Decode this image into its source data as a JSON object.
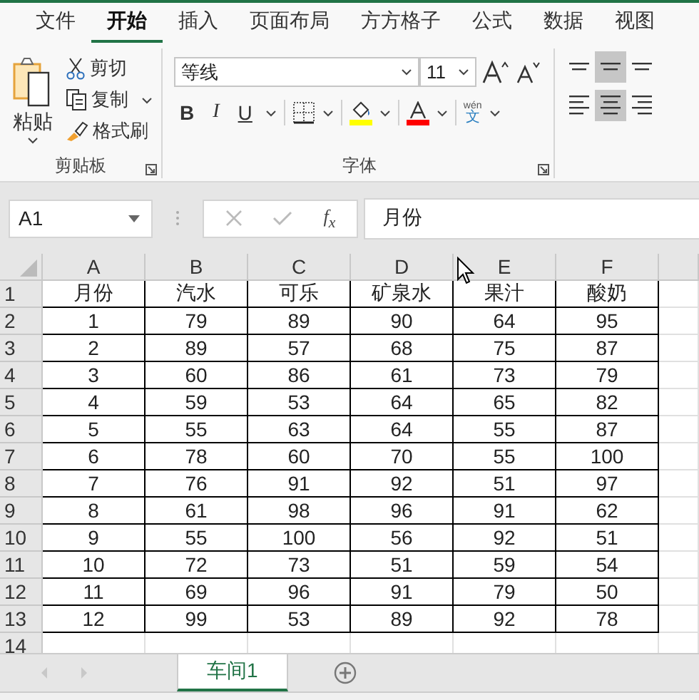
{
  "menu_tabs": [
    {
      "label": "文件",
      "selected": false
    },
    {
      "label": "开始",
      "selected": true
    },
    {
      "label": "插入",
      "selected": false
    },
    {
      "label": "页面布局",
      "selected": false
    },
    {
      "label": "方方格子",
      "selected": false
    },
    {
      "label": "公式",
      "selected": false
    },
    {
      "label": "数据",
      "selected": false
    },
    {
      "label": "视图",
      "selected": false
    }
  ],
  "clipboard": {
    "paste": "粘贴",
    "cut": "剪切",
    "copy": "复制",
    "format_painter": "格式刷",
    "group_label": "剪贴板"
  },
  "font": {
    "font_name": "等线",
    "font_size": "11",
    "bold": "B",
    "italic": "I",
    "underline": "U",
    "color_buttons": [
      {
        "kind": "fill",
        "color": "#ffff00"
      },
      {
        "kind": "font",
        "color": "#ff0000"
      }
    ],
    "phonetic_top": "wén",
    "phonetic_char": "文",
    "group_label": "字体"
  },
  "alignment": [
    {
      "kind": "top",
      "selected": false
    },
    {
      "kind": "middle",
      "selected": true
    },
    {
      "kind": "bottom",
      "selected": false
    },
    {
      "kind": "left",
      "selected": false
    },
    {
      "kind": "center",
      "selected": true
    },
    {
      "kind": "right",
      "selected": false
    }
  ],
  "formula_bar": {
    "name_box": "A1",
    "function_label": "f$_{x}$",
    "content": "月份"
  },
  "columns": [
    "A",
    "B",
    "C",
    "D",
    "E",
    "F"
  ],
  "rows": [
    {
      "number": "1",
      "cells": [
        "月份",
        "汽水",
        "可乐",
        "矿泉水",
        "果汁",
        "酸奶"
      ]
    },
    {
      "number": "2",
      "cells": [
        "1",
        "79",
        "89",
        "90",
        "64",
        "95"
      ]
    },
    {
      "number": "3",
      "cells": [
        "2",
        "89",
        "57",
        "68",
        "75",
        "87"
      ]
    },
    {
      "number": "4",
      "cells": [
        "3",
        "60",
        "86",
        "61",
        "73",
        "79"
      ]
    },
    {
      "number": "5",
      "cells": [
        "4",
        "59",
        "53",
        "64",
        "65",
        "82"
      ]
    },
    {
      "number": "6",
      "cells": [
        "5",
        "55",
        "63",
        "64",
        "55",
        "87"
      ]
    },
    {
      "number": "7",
      "cells": [
        "6",
        "78",
        "60",
        "70",
        "55",
        "100"
      ]
    },
    {
      "number": "8",
      "cells": [
        "7",
        "76",
        "91",
        "92",
        "51",
        "97"
      ]
    },
    {
      "number": "9",
      "cells": [
        "8",
        "61",
        "98",
        "96",
        "91",
        "62"
      ]
    },
    {
      "number": "10",
      "cells": [
        "9",
        "55",
        "100",
        "56",
        "92",
        "51"
      ]
    },
    {
      "number": "11",
      "cells": [
        "10",
        "72",
        "73",
        "51",
        "59",
        "54"
      ]
    },
    {
      "number": "12",
      "cells": [
        "11",
        "69",
        "96",
        "91",
        "79",
        "50"
      ]
    },
    {
      "number": "13",
      "cells": [
        "12",
        "99",
        "53",
        "89",
        "92",
        "78"
      ]
    },
    {
      "number": "14"
    }
  ],
  "sheet_tabs": [
    {
      "label": "车间1",
      "selected": true
    }
  ]
}
